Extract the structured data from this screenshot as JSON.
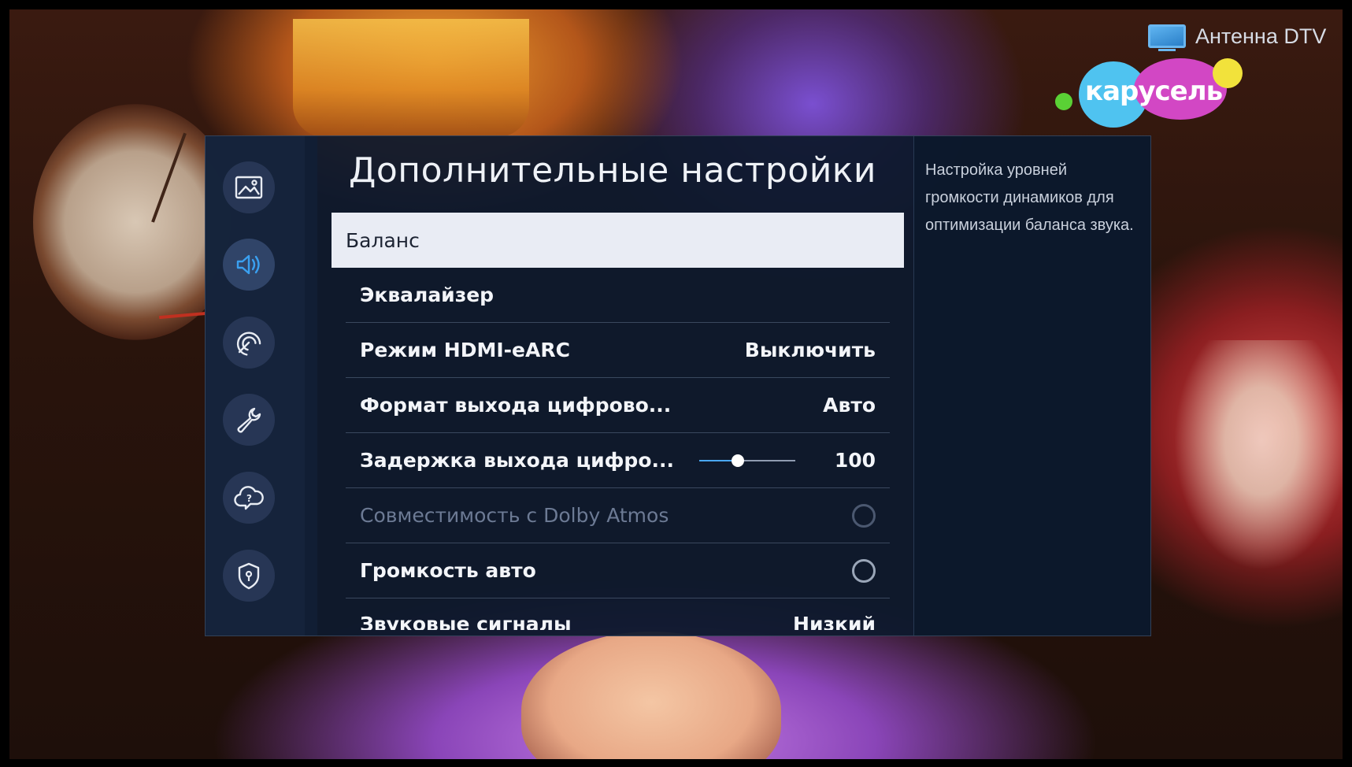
{
  "channel": {
    "source_label": "Антенна DTV",
    "logo_text": "карусель"
  },
  "settings": {
    "title": "Дополнительные настройки",
    "nav": [
      {
        "name": "picture",
        "icon": "picture-icon",
        "active": false
      },
      {
        "name": "sound",
        "icon": "sound-icon",
        "active": true
      },
      {
        "name": "broadcast",
        "icon": "broadcast-icon",
        "active": false
      },
      {
        "name": "general",
        "icon": "wrench-icon",
        "active": false
      },
      {
        "name": "support",
        "icon": "help-cloud-icon",
        "active": false
      },
      {
        "name": "privacy",
        "icon": "shield-icon",
        "active": false
      }
    ],
    "items": [
      {
        "label": "Баланс",
        "selected": true
      },
      {
        "label": "Эквалайзер"
      },
      {
        "label": "Режим HDMI-eARC",
        "value": "Выключить"
      },
      {
        "label": "Формат выхода цифрово...",
        "value": "Авто"
      },
      {
        "label": "Задержка выхода цифро...",
        "value": "100",
        "slider_fraction": 0.4
      },
      {
        "label": "Совместимость с Dolby Atmos",
        "disabled": true,
        "toggle": false
      },
      {
        "label": "Громкость авто",
        "toggle": false
      },
      {
        "label": "Звуковые сигналы",
        "value": "Низкий"
      }
    ],
    "description": "Настройка уровней громкости динамиков для оптимизации баланса звука."
  },
  "colors": {
    "panel_bg": "#0e1a2e",
    "selected_bg": "#e9ecf4",
    "slider_accent": "#4aa7f2"
  }
}
